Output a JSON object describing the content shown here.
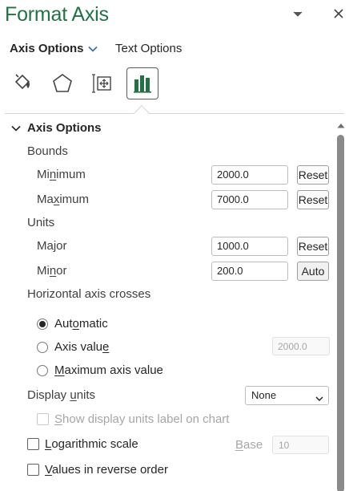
{
  "pane": {
    "title": "Format Axis",
    "options_icon": "chevron-down-icon",
    "close_icon": "close-icon"
  },
  "tabs": [
    {
      "label": "Axis Options",
      "active": true
    },
    {
      "label": "Text Options",
      "active": false
    }
  ],
  "categories": [
    {
      "icon": "fill-line-icon",
      "selected": false
    },
    {
      "icon": "effects-pentagon-icon",
      "selected": false
    },
    {
      "icon": "size-properties-icon",
      "selected": false
    },
    {
      "icon": "axis-options-bar-chart-icon",
      "selected": true
    }
  ],
  "section": {
    "title": "Axis Options",
    "bounds": {
      "label": "Bounds",
      "minimum": {
        "label_pre": "Mi",
        "label_ul": "n",
        "label_post": "imum",
        "value": "2000.0",
        "button": "Reset"
      },
      "maximum": {
        "label_pre": "Ma",
        "label_ul": "x",
        "label_post": "imum",
        "value": "7000.0",
        "button": "Reset"
      }
    },
    "units": {
      "label": "Units",
      "major": {
        "label": "Major",
        "value": "1000.0",
        "button": "Reset"
      },
      "minor": {
        "label_pre": "Mi",
        "label_ul": "n",
        "label_post": "or",
        "value": "200.0",
        "button": "Auto"
      }
    },
    "crosses": {
      "label": "Horizontal axis crosses",
      "automatic": {
        "label_pre": "Aut",
        "label_ul": "o",
        "label_post": "matic",
        "selected": true
      },
      "axis_value": {
        "label_pre": "Axis valu",
        "label_ul": "e",
        "label_post": "",
        "value": "2000.0",
        "selected": false
      },
      "max_value": {
        "label_pre": "",
        "label_ul": "M",
        "label_post": "aximum axis value",
        "selected": false
      }
    },
    "display_units": {
      "label_pre": "Display ",
      "label_ul": "u",
      "label_post": "nits",
      "value": "None",
      "show_label": {
        "label_pre": "",
        "label_ul": "S",
        "label_post": "how display units label on chart",
        "checked": false
      }
    },
    "logarithmic": {
      "label_pre": "",
      "label_ul": "L",
      "label_post": "ogarithmic scale",
      "checked": false,
      "base_label_ul": "B",
      "base_label_post": "ase",
      "base_value": "10"
    },
    "reverse": {
      "label_pre": "",
      "label_ul": "V",
      "label_post": "alues in reverse order",
      "checked": false
    }
  },
  "colors": {
    "accent": "#217346",
    "selected_bar": "#217346"
  }
}
